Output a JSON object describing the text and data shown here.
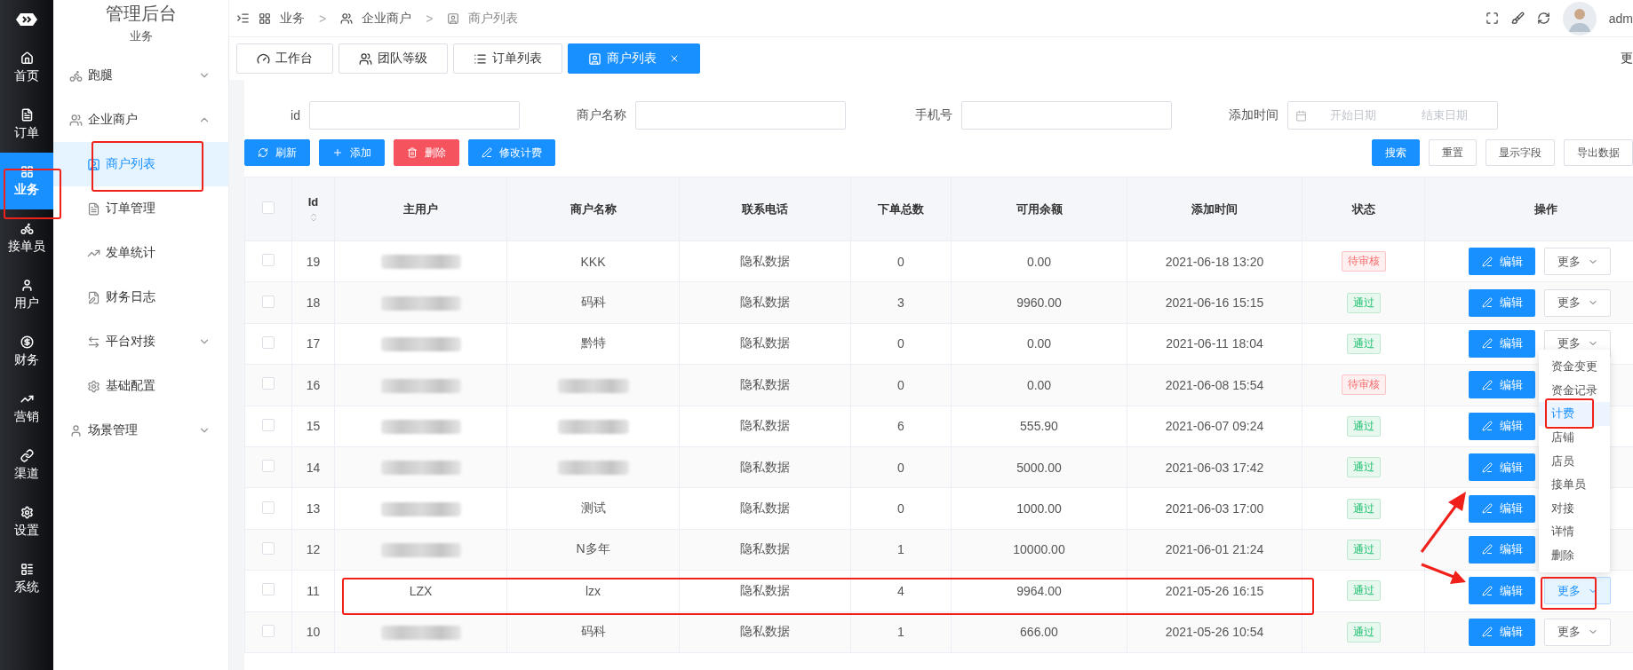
{
  "rail": {
    "items": [
      {
        "label": "首页",
        "selected": false
      },
      {
        "label": "订单",
        "selected": false
      },
      {
        "label": "业务",
        "selected": true
      },
      {
        "label": "接单员",
        "selected": false
      },
      {
        "label": "用户",
        "selected": false
      },
      {
        "label": "财务",
        "selected": false
      },
      {
        "label": "营销",
        "selected": false
      },
      {
        "label": "渠道",
        "selected": false
      },
      {
        "label": "设置",
        "selected": false
      },
      {
        "label": "系统",
        "selected": false
      }
    ]
  },
  "sidebar": {
    "title": "管理后台",
    "section": "业务",
    "menu": [
      {
        "label": "跑腿",
        "expanded": false
      },
      {
        "label": "企业商户",
        "expanded": true,
        "children": [
          {
            "label": "商户列表",
            "selected": true
          },
          {
            "label": "订单管理",
            "selected": false
          },
          {
            "label": "发单统计",
            "selected": false
          },
          {
            "label": "财务日志",
            "selected": false
          },
          {
            "label": "平台对接",
            "selected": false,
            "expanded": false
          },
          {
            "label": "基础配置",
            "selected": false
          }
        ]
      },
      {
        "label": "场景管理",
        "expanded": false
      }
    ]
  },
  "header": {
    "breadcrumb": [
      {
        "label": "业务"
      },
      {
        "separator": ">",
        "label": "企业商户"
      },
      {
        "separator": ">",
        "label": "商户列表"
      }
    ],
    "user": "adm"
  },
  "tabs": [
    {
      "label": "工作台",
      "selected": false,
      "closable": false
    },
    {
      "label": "团队等级",
      "selected": false,
      "closable": false
    },
    {
      "label": "订单列表",
      "selected": false,
      "closable": false
    },
    {
      "label": "商户列表",
      "selected": true,
      "closable": true
    }
  ],
  "tabs_more": "更",
  "filters": [
    {
      "label": "id",
      "kind": "text"
    },
    {
      "label": "商户名称",
      "kind": "text"
    },
    {
      "label": "手机号",
      "kind": "text"
    },
    {
      "label": "添加时间",
      "kind": "daterange",
      "start_placeholder": "开始日期",
      "end_placeholder": "结束日期"
    }
  ],
  "toolbar_left": [
    {
      "label": "刷新",
      "kind": "primary"
    },
    {
      "label": "添加",
      "kind": "primary"
    },
    {
      "label": "删除",
      "kind": "danger"
    },
    {
      "label": "修改计费",
      "kind": "primary"
    }
  ],
  "toolbar_right": [
    {
      "label": "搜索",
      "kind": "primary"
    },
    {
      "label": "重置",
      "kind": "default"
    },
    {
      "label": "显示字段",
      "kind": "default"
    },
    {
      "label": "导出数据",
      "kind": "default"
    }
  ],
  "table": {
    "header_checked": false,
    "columns": [
      {
        "label": "Id",
        "sortable": true
      },
      {
        "label": "主用户",
        "sortable": false
      },
      {
        "label": "商户名称",
        "sortable": false
      },
      {
        "label": "联系电话",
        "sortable": false
      },
      {
        "label": "下单总数",
        "sortable": false
      },
      {
        "label": "可用余额",
        "sortable": false
      },
      {
        "label": "添加时间",
        "sortable": false
      },
      {
        "label": "状态",
        "sortable": false
      },
      {
        "label": "操作",
        "sortable": false
      }
    ],
    "rows": [
      {
        "checked": false,
        "id": "19",
        "owner_blurred": true,
        "name": "KKK",
        "name_blurred": false,
        "phone": "隐私数据",
        "orders": "0",
        "balance": "0.00",
        "time": "2021-06-18 13:20",
        "status": {
          "text": "待审核",
          "kind": "pending"
        },
        "edit": "编辑",
        "more": "更多",
        "more_open": false
      },
      {
        "checked": false,
        "id": "18",
        "owner_blurred": true,
        "name": "码科",
        "name_blurred": false,
        "phone": "隐私数据",
        "orders": "3",
        "balance": "9960.00",
        "time": "2021-06-16 15:15",
        "status": {
          "text": "通过",
          "kind": "approved"
        },
        "edit": "编辑",
        "more": "更多",
        "more_open": false
      },
      {
        "checked": false,
        "id": "17",
        "owner_blurred": true,
        "name": "黔特",
        "name_blurred": false,
        "phone": "隐私数据",
        "orders": "0",
        "balance": "0.00",
        "time": "2021-06-11 18:04",
        "status": {
          "text": "通过",
          "kind": "approved"
        },
        "edit": "编辑",
        "more": "更多",
        "more_open": false
      },
      {
        "checked": false,
        "id": "16",
        "owner_blurred": true,
        "name_blurred": true,
        "phone": "隐私数据",
        "orders": "0",
        "balance": "0.00",
        "time": "2021-06-08 15:54",
        "status": {
          "text": "待审核",
          "kind": "pending"
        },
        "edit": "编辑"
      },
      {
        "checked": false,
        "id": "15",
        "owner_blurred": true,
        "name_blurred": true,
        "phone": "隐私数据",
        "orders": "6",
        "balance": "555.90",
        "time": "2021-06-07 09:24",
        "status": {
          "text": "通过",
          "kind": "approved"
        },
        "edit": "编辑"
      },
      {
        "checked": false,
        "id": "14",
        "owner_blurred": true,
        "name_blurred": true,
        "phone": "隐私数据",
        "orders": "0",
        "balance": "5000.00",
        "time": "2021-06-03 17:42",
        "status": {
          "text": "通过",
          "kind": "approved"
        },
        "edit": "编辑"
      },
      {
        "checked": false,
        "id": "13",
        "owner_blurred": true,
        "name": "测试",
        "name_blurred": false,
        "phone": "隐私数据",
        "orders": "0",
        "balance": "1000.00",
        "time": "2021-06-03 17:00",
        "status": {
          "text": "通过",
          "kind": "approved"
        },
        "edit": "编辑"
      },
      {
        "checked": false,
        "id": "12",
        "owner_blurred": true,
        "name": "N多年",
        "name_blurred": false,
        "phone": "隐私数据",
        "orders": "1",
        "balance": "10000.00",
        "time": "2021-06-01 21:24",
        "status": {
          "text": "通过",
          "kind": "approved"
        },
        "edit": "编辑"
      },
      {
        "checked": false,
        "id": "11",
        "owner": "LZX",
        "owner_blurred": false,
        "name": "lzx",
        "name_blurred": false,
        "phone": "隐私数据",
        "orders": "4",
        "balance": "9964.00",
        "time": "2021-05-26 16:15",
        "status": {
          "text": "通过",
          "kind": "approved"
        },
        "edit": "编辑",
        "more": "更多",
        "more_open": true
      },
      {
        "checked": false,
        "id": "10",
        "owner_blurred": true,
        "name": "码科",
        "name_blurred": false,
        "phone": "隐私数据",
        "orders": "1",
        "balance": "666.00",
        "time": "2021-05-26 10:54",
        "status": {
          "text": "通过",
          "kind": "approved"
        },
        "edit": "编辑",
        "more": "更多",
        "more_open": false
      }
    ]
  },
  "dropdown": {
    "items": [
      {
        "label": "资金变更",
        "selected": false
      },
      {
        "label": "资金记录",
        "selected": false
      },
      {
        "label": "计费",
        "selected": true
      },
      {
        "label": "店铺",
        "selected": false
      },
      {
        "label": "店员",
        "selected": false
      },
      {
        "label": "接单员",
        "selected": false
      },
      {
        "label": "对接",
        "selected": false
      },
      {
        "label": "详情",
        "selected": false
      },
      {
        "label": "删除",
        "selected": false
      }
    ]
  }
}
